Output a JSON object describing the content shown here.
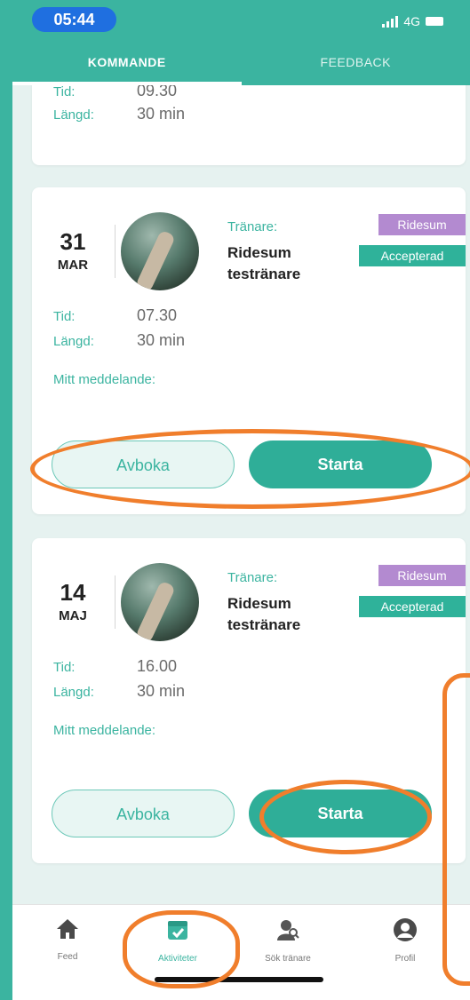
{
  "status": {
    "time": "05:44",
    "network": "4G"
  },
  "tabs": [
    {
      "label": "KOMMANDE"
    },
    {
      "label": "FEEDBACK"
    }
  ],
  "top_card": {
    "tid_label": "Tid:",
    "tid_value": "09.30",
    "langd_label": "Längd:",
    "langd_value": "30 min"
  },
  "cards": [
    {
      "day": "31",
      "month": "MAR",
      "trainer_label": "Tränare:",
      "trainer_name": "Ridesum testränare",
      "badge_type": "Ridesum",
      "badge_status": "Accepterad",
      "tid_label": "Tid:",
      "tid_value": "07.30",
      "langd_label": "Längd:",
      "langd_value": "30 min",
      "message_label": "Mitt meddelande:",
      "cancel_label": "Avboka",
      "start_label": "Starta"
    },
    {
      "day": "14",
      "month": "MAJ",
      "trainer_label": "Tränare:",
      "trainer_name": "Ridesum testränare",
      "badge_type": "Ridesum",
      "badge_status": "Accepterad",
      "tid_label": "Tid:",
      "tid_value": "16.00",
      "langd_label": "Längd:",
      "langd_value": "30 min",
      "message_label": "Mitt meddelande:",
      "cancel_label": "Avboka",
      "start_label": "Starta"
    }
  ],
  "nav": [
    {
      "label": "Feed",
      "icon": "home-icon"
    },
    {
      "label": "Aktiviteter",
      "icon": "calendar-check-icon"
    },
    {
      "label": "Sök tränare",
      "icon": "search-trainer-icon"
    },
    {
      "label": "Profil",
      "icon": "profile-icon"
    }
  ],
  "colors": {
    "accent": "#3bb4a0",
    "annotation": "#f07e2c",
    "badge_purple": "#b38ad0"
  }
}
